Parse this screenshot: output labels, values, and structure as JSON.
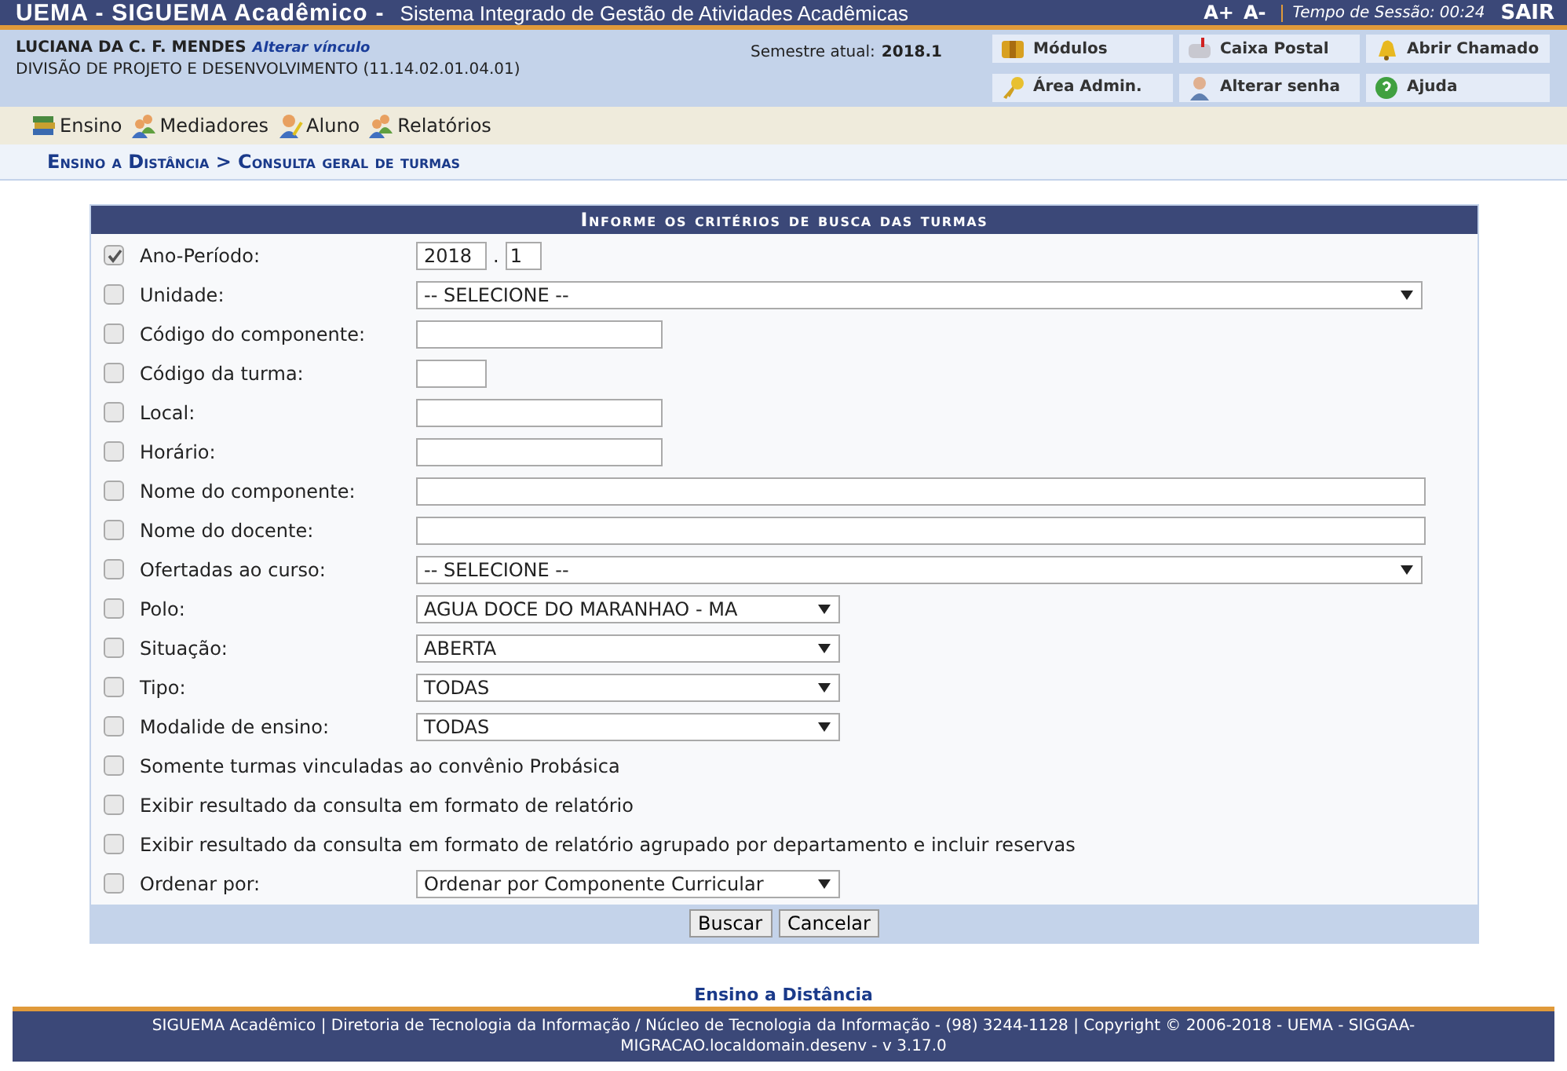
{
  "header": {
    "system": "UEMA - SIGUEMA Acadêmico -",
    "subtitle": "Sistema Integrado de Gestão de Atividades Acadêmicas",
    "font_up": "A+",
    "font_down": "A-",
    "session_label": "Tempo de Sessão:",
    "session_time": "00:24",
    "logout": "SAIR"
  },
  "user": {
    "name": "LUCIANA DA C. F. MENDES",
    "change_link": "Alterar vínculo",
    "unit": "DIVISÃO DE PROJETO E DESENVOLVIMENTO (11.14.02.01.04.01)",
    "semester_label": "Semestre atual:",
    "semester": "2018.1"
  },
  "shortcuts": [
    {
      "label": "Módulos"
    },
    {
      "label": "Caixa Postal"
    },
    {
      "label": "Abrir Chamado"
    },
    {
      "label": "Área Admin."
    },
    {
      "label": "Alterar senha"
    },
    {
      "label": "Ajuda"
    }
  ],
  "menu": [
    {
      "label": "Ensino"
    },
    {
      "label": "Mediadores"
    },
    {
      "label": "Aluno"
    },
    {
      "label": "Relatórios"
    }
  ],
  "breadcrumb": "Ensino a Distância > Consulta geral de turmas",
  "form": {
    "title": "Informe os critérios de busca das turmas",
    "rows": [
      {
        "label": "Ano-Período:",
        "checked": true,
        "kind": "year-period",
        "values": [
          "2018",
          "1"
        ],
        "separator": "."
      },
      {
        "label": "Unidade:",
        "checked": false,
        "kind": "select-long",
        "value": "-- SELECIONE --"
      },
      {
        "label": "Código do componente:",
        "checked": false,
        "kind": "text"
      },
      {
        "label": "Código da turma:",
        "checked": false,
        "kind": "text-short"
      },
      {
        "label": "Local:",
        "checked": false,
        "kind": "text"
      },
      {
        "label": "Horário:",
        "checked": false,
        "kind": "text"
      },
      {
        "label": "Nome do componente:",
        "checked": false,
        "kind": "text-long"
      },
      {
        "label": "Nome do docente:",
        "checked": false,
        "kind": "text-long"
      },
      {
        "label": "Ofertadas ao curso:",
        "checked": false,
        "kind": "select-long",
        "value": "-- SELECIONE --"
      },
      {
        "label": "Polo:",
        "checked": false,
        "kind": "select",
        "value": "AGUA DOCE DO MARANHAO - MA"
      },
      {
        "label": "Situação:",
        "checked": false,
        "kind": "select",
        "value": "ABERTA"
      },
      {
        "label": "Tipo:",
        "checked": false,
        "kind": "select",
        "value": "TODAS"
      },
      {
        "label": "Modalide de ensino:",
        "checked": false,
        "kind": "select",
        "value": "TODAS"
      },
      {
        "label": "Somente turmas vinculadas ao convênio Probásica",
        "checked": false,
        "kind": "none"
      },
      {
        "label": "Exibir resultado da consulta em formato de relatório",
        "checked": false,
        "kind": "none"
      },
      {
        "label": "Exibir resultado da consulta em formato de relatório agrupado por departamento e incluir reservas",
        "checked": false,
        "kind": "none"
      },
      {
        "label": "Ordenar por:",
        "checked": false,
        "kind": "select",
        "value": "Ordenar por Componente Curricular"
      }
    ],
    "buttons": [
      "Buscar",
      "Cancelar"
    ]
  },
  "footer": {
    "link": "Ensino a Distância",
    "text": "SIGUEMA Acadêmico | Diretoria de Tecnologia da Informação / Núcleo de Tecnologia da Informação - (98) 3244-1128 | Copyright © 2006-2018 - UEMA - SIGGAA-MIGRACAO.localdomain.desenv - v 3.17.0"
  }
}
